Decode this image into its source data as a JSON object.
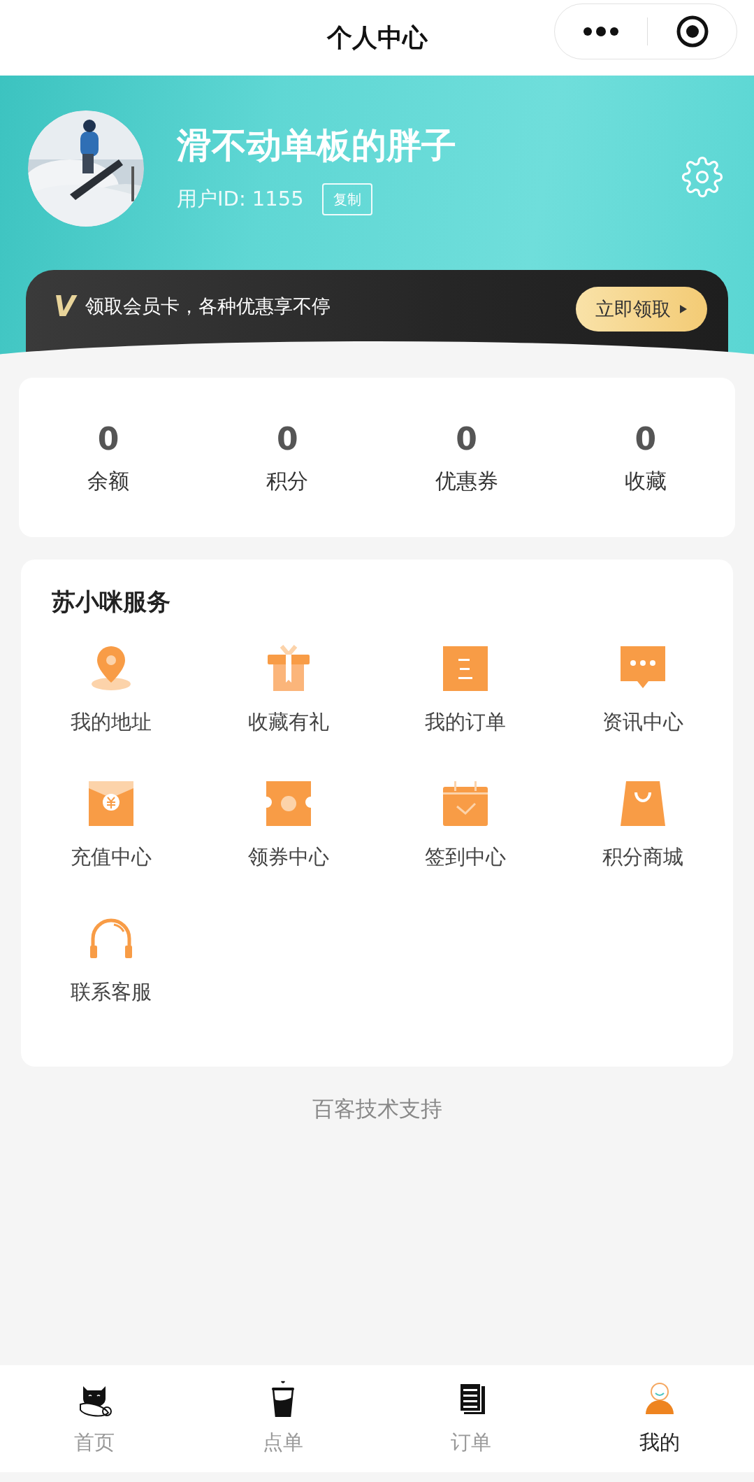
{
  "top_bar": {
    "title": "个人中心"
  },
  "profile": {
    "name": "滑不动单板的胖子",
    "user_id": "用户ID: 1155",
    "copy_button": "复制"
  },
  "member_banner": {
    "badge": "V",
    "text": "领取会员卡，各种优惠享不停",
    "button": "立即领取"
  },
  "stats": [
    {
      "value": "0",
      "label": "余额"
    },
    {
      "value": "0",
      "label": "积分"
    },
    {
      "value": "0",
      "label": "优惠券"
    },
    {
      "value": "0",
      "label": "收藏"
    }
  ],
  "services": {
    "title": "苏小咪服务",
    "items": [
      {
        "kind": "location",
        "label": "我的地址"
      },
      {
        "kind": "gift",
        "label": "收藏有礼"
      },
      {
        "kind": "list",
        "label": "我的订单"
      },
      {
        "kind": "chat",
        "label": "资讯中心"
      },
      {
        "kind": "envelope",
        "label": "充值中心"
      },
      {
        "kind": "ticket",
        "label": "领券中心"
      },
      {
        "kind": "calendar",
        "label": "签到中心"
      },
      {
        "kind": "bag",
        "label": "积分商城"
      },
      {
        "kind": "headset",
        "label": "联系客服"
      }
    ]
  },
  "footer": "百客技术支持",
  "tabs": [
    {
      "kind": "cat",
      "label": "首页",
      "selected": false
    },
    {
      "kind": "cup",
      "label": "点单",
      "selected": false
    },
    {
      "kind": "document",
      "label": "订单",
      "selected": false
    },
    {
      "kind": "person",
      "label": "我的",
      "selected": true
    }
  ]
}
